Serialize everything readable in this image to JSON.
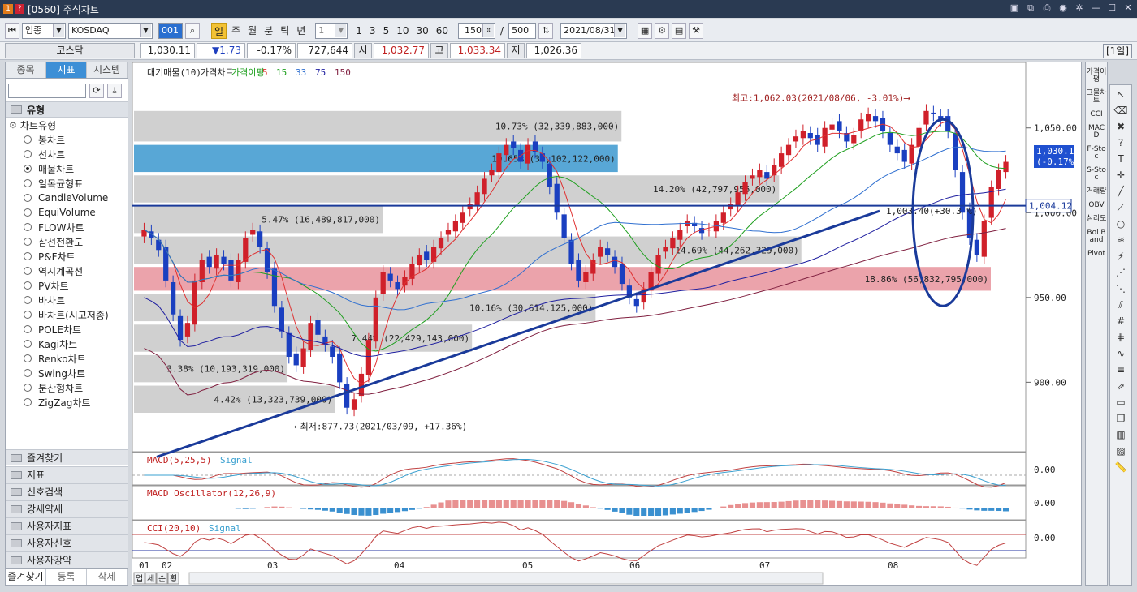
{
  "window": {
    "title": "[0560] 주식차트",
    "icon_badge1": "1",
    "icon_badge2": "?"
  },
  "toolbar": {
    "market_select": "업종",
    "symbol_select": "KOSDAQ",
    "code_input": "001",
    "periods": [
      "일",
      "주",
      "월",
      "분",
      "틱",
      "년"
    ],
    "active_period": "일",
    "interval_select": "1",
    "quick_counts": [
      "1",
      "3",
      "5",
      "10",
      "30",
      "60"
    ],
    "bar_count": "150",
    "separator": "/",
    "max_count": "500",
    "date": "2021/08/31"
  },
  "quote": {
    "name": "코스닥",
    "price": "1,030.11",
    "change": "▼1.73",
    "change_pct": "-0.17%",
    "volume": "727,644",
    "open_label": "시",
    "open": "1,032.77",
    "high_label": "고",
    "high": "1,033.34",
    "low_label": "저",
    "low": "1,026.36",
    "period_badge": "[1일]"
  },
  "sidebar": {
    "tabs": [
      "종목",
      "지표",
      "시스템"
    ],
    "active_tab": "지표",
    "group_title": "유형",
    "tree_title": "차트유형",
    "chart_types": [
      "봉차트",
      "선차트",
      "매물차트",
      "일목균형표",
      "CandleVolume",
      "EquiVolume",
      "FLOW차트",
      "삼선전환도",
      "P&F차트",
      "역시계곡선",
      "PV차트",
      "바차트",
      "바차트(시고저종)",
      "POLE차트",
      "Kagi차트",
      "Renko차트",
      "Swing차트",
      "분산형차트",
      "ZigZag차트"
    ],
    "selected_type": "매물차트",
    "bottom_groups": [
      "즐겨찾기",
      "지표",
      "신호검색",
      "강세약세",
      "사용자지표",
      "사용자신호",
      "사용자강약"
    ],
    "footer": [
      "즐겨찾기",
      "등록",
      "삭제"
    ]
  },
  "right_indicators": [
    "가격이평",
    "그물차트",
    "CCI",
    "MACD",
    "F-Stoc",
    "S-Stoc",
    "거래량",
    "OBV",
    "심리도",
    "Bol Band",
    "Pivot"
  ],
  "chart_bottom": {
    "tabs": [
      "업",
      "세",
      "순",
      "횡"
    ]
  },
  "chart_data": {
    "type": "candlestick",
    "legend": [
      "대기매물(10)",
      "가격차트",
      "가격이평",
      "5",
      "15",
      "33",
      "75",
      "150"
    ],
    "legend_colors": {
      "ma5": "#e03030",
      "ma15": "#20a020",
      "ma33": "#3070d0",
      "ma75": "#2020a0",
      "ma150": "#802040"
    },
    "price_axis": {
      "ticks": [
        "1,050.00",
        "1,000.00",
        "950.00",
        "900.00"
      ],
      "ylim": [
        860,
        1080
      ]
    },
    "x_months": [
      "01",
      "02",
      "03",
      "04",
      "05",
      "06",
      "07",
      "08"
    ],
    "last_price_badge": [
      "1,030.11",
      "(-0.17%)"
    ],
    "level_badge": "1,004.12",
    "annotations": {
      "high": "최고:1,062.03(2021/08/06, -3.01%)",
      "low": "최저:877.73(2021/03/09, +17.36%)",
      "level": "1,003.40(+30.3 %)"
    },
    "volume_profile": [
      {
        "label": "10.73% (32,339,883,000)",
        "low": 1042,
        "high": 1060,
        "value": 10.73,
        "color": "#c8c8c8"
      },
      {
        "label": "10.65% (32,102,122,000)",
        "low": 1024,
        "high": 1040,
        "value": 10.65,
        "color": "#3b98cf"
      },
      {
        "label": "14.20% (42,797,956,000)",
        "low": 1006,
        "high": 1022,
        "value": 14.2,
        "color": "#c8c8c8"
      },
      {
        "label": "5.47% (16,489,817,000)",
        "low": 988,
        "high": 1004,
        "value": 5.47,
        "color": "#c8c8c8"
      },
      {
        "label": "14.69% (44,262,329,000)",
        "low": 970,
        "high": 986,
        "value": 14.69,
        "color": "#c8c8c8"
      },
      {
        "label": "18.86% (56,832,795,000)",
        "low": 954,
        "high": 968,
        "value": 18.86,
        "color": "#e8939c"
      },
      {
        "label": "10.16% (30,614,125,000)",
        "low": 936,
        "high": 952,
        "value": 10.16,
        "color": "#c8c8c8"
      },
      {
        "label": "7.44% (22,429,143,000)",
        "low": 918,
        "high": 934,
        "value": 7.44,
        "color": "#c8c8c8"
      },
      {
        "label": "3.38% (10,193,319,000)",
        "low": 900,
        "high": 916,
        "value": 3.38,
        "color": "#c8c8c8"
      },
      {
        "label": "4.42% (13,323,739,000)",
        "low": 882,
        "high": 898,
        "value": 4.42,
        "color": "#c8c8c8"
      }
    ],
    "close": [
      990,
      985,
      978,
      960,
      940,
      925,
      935,
      960,
      972,
      968,
      975,
      970,
      960,
      972,
      985,
      990,
      980,
      965,
      945,
      930,
      915,
      910,
      920,
      935,
      928,
      922,
      915,
      900,
      885,
      890,
      905,
      925,
      950,
      965,
      960,
      955,
      962,
      970,
      975,
      972,
      980,
      985,
      990,
      995,
      1000,
      1005,
      1012,
      1020,
      1025,
      1035,
      1040,
      1038,
      1030,
      1040,
      1036,
      1030,
      1015,
      1000,
      985,
      970,
      960,
      965,
      972,
      980,
      975,
      968,
      958,
      950,
      945,
      955,
      965,
      975,
      980,
      985,
      990,
      995,
      992,
      988,
      990,
      995,
      1000,
      1005,
      1012,
      1018,
      1022,
      1025,
      1020,
      1028,
      1035,
      1040,
      1045,
      1048,
      1044,
      1040,
      1050,
      1052,
      1048,
      1042,
      1046,
      1055,
      1058,
      1054,
      1048,
      1040,
      1035,
      1030,
      1040,
      1050,
      1060,
      1058,
      1055,
      1048,
      1025,
      1000,
      985,
      975,
      995,
      1015,
      1025,
      1030
    ],
    "panels": [
      {
        "name": "MACD",
        "title": "MACD(5,25,5)",
        "signal": "Signal",
        "value": "0.00",
        "zero_label": "0"
      },
      {
        "name": "MACD Oscillator",
        "title": "MACD Oscillator(12,26,9)",
        "value": "0.00"
      },
      {
        "name": "CCI",
        "title": "CCI(20,10)",
        "signal": "Signal",
        "value": "0.00",
        "upper": "100",
        "lower": "-100"
      }
    ]
  }
}
